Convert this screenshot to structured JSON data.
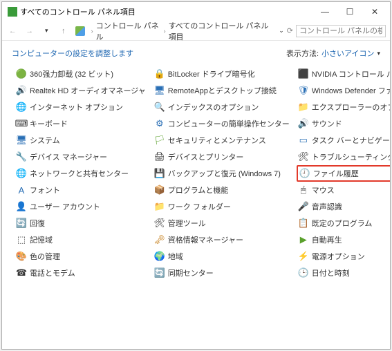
{
  "window": {
    "title": "すべてのコントロール パネル項目",
    "min": "—",
    "max": "☐",
    "close": "✕"
  },
  "nav": {
    "crumb1": "コントロール パネル",
    "crumb2": "すべてのコントロール パネル項目",
    "search_placeholder": "コントロール パネルの検索"
  },
  "sub": {
    "title": "コンピューターの設定を調整します",
    "view_label": "表示方法:",
    "view_value": "小さいアイコン"
  },
  "items": [
    {
      "label": "360强力卸载 (32 ビット)",
      "icon": "🟢",
      "c": "#3a9b3a"
    },
    {
      "label": "BitLocker ドライブ暗号化",
      "icon": "🔒",
      "c": "#333"
    },
    {
      "label": "NVIDIA コントロール パネル",
      "icon": "⬛",
      "c": "#5aa02c"
    },
    {
      "label": "Realtek HD オーディオマネージャ",
      "icon": "🔊",
      "c": "#c47a12"
    },
    {
      "label": "RemoteAppとデスクトップ接続",
      "icon": "🖥",
      "c": "#2a6fb5"
    },
    {
      "label": "Windows Defender ファイアウォール",
      "icon": "🛡",
      "c": "#2a6fb5"
    },
    {
      "label": "インターネット オプション",
      "icon": "🌐",
      "c": "#2a6fb5"
    },
    {
      "label": "インデックスのオプション",
      "icon": "🔍",
      "c": "#2a6fb5"
    },
    {
      "label": "エクスプローラーのオプション",
      "icon": "📁",
      "c": "#d9a441"
    },
    {
      "label": "キーボード",
      "icon": "⌨",
      "c": "#333"
    },
    {
      "label": "コンピューターの簡単操作センター",
      "icon": "⚙",
      "c": "#2a6fb5"
    },
    {
      "label": "サウンド",
      "icon": "🔊",
      "c": "#333"
    },
    {
      "label": "システム",
      "icon": "🖥",
      "c": "#2a6fb5"
    },
    {
      "label": "セキュリティとメンテナンス",
      "icon": "🏳",
      "c": "#5aa02c"
    },
    {
      "label": "タスク バーとナビゲーション",
      "icon": "▭",
      "c": "#2a6fb5"
    },
    {
      "label": "デバイス マネージャー",
      "icon": "🔧",
      "c": "#333"
    },
    {
      "label": "デバイスとプリンター",
      "icon": "🖨",
      "c": "#333"
    },
    {
      "label": "トラブルシューティング",
      "icon": "🛠",
      "c": "#333"
    },
    {
      "label": "ネットワークと共有センター",
      "icon": "🌐",
      "c": "#2a6fb5"
    },
    {
      "label": "バックアップと復元 (Windows 7)",
      "icon": "💾",
      "c": "#5aa02c"
    },
    {
      "label": "ファイル履歴",
      "icon": "🕘",
      "c": "#5aa02c",
      "hl": true
    },
    {
      "label": "フォント",
      "icon": "A",
      "c": "#2a6fb5"
    },
    {
      "label": "プログラムと機能",
      "icon": "📦",
      "c": "#c47a12"
    },
    {
      "label": "マウス",
      "icon": "🖱",
      "c": "#333"
    },
    {
      "label": "ユーザー アカウント",
      "icon": "👤",
      "c": "#5aa02c"
    },
    {
      "label": "ワーク フォルダー",
      "icon": "📁",
      "c": "#d9a441"
    },
    {
      "label": "音声認識",
      "icon": "🎤",
      "c": "#2a6fb5"
    },
    {
      "label": "回復",
      "icon": "🔄",
      "c": "#5aa02c"
    },
    {
      "label": "管理ツール",
      "icon": "🛠",
      "c": "#333"
    },
    {
      "label": "既定のプログラム",
      "icon": "📋",
      "c": "#2a6fb5"
    },
    {
      "label": "記憶域",
      "icon": "⬚",
      "c": "#333"
    },
    {
      "label": "資格情報マネージャー",
      "icon": "🗝",
      "c": "#c47a12"
    },
    {
      "label": "自動再生",
      "icon": "▶",
      "c": "#5aa02c"
    },
    {
      "label": "色の管理",
      "icon": "🎨",
      "c": "#c47a12"
    },
    {
      "label": "地域",
      "icon": "🌍",
      "c": "#2a6fb5"
    },
    {
      "label": "電源オプション",
      "icon": "⚡",
      "c": "#5aa02c"
    },
    {
      "label": "電話とモデム",
      "icon": "☎",
      "c": "#333"
    },
    {
      "label": "同期センター",
      "icon": "🔄",
      "c": "#5aa02c"
    },
    {
      "label": "日付と時刻",
      "icon": "🕒",
      "c": "#2a6fb5"
    }
  ]
}
